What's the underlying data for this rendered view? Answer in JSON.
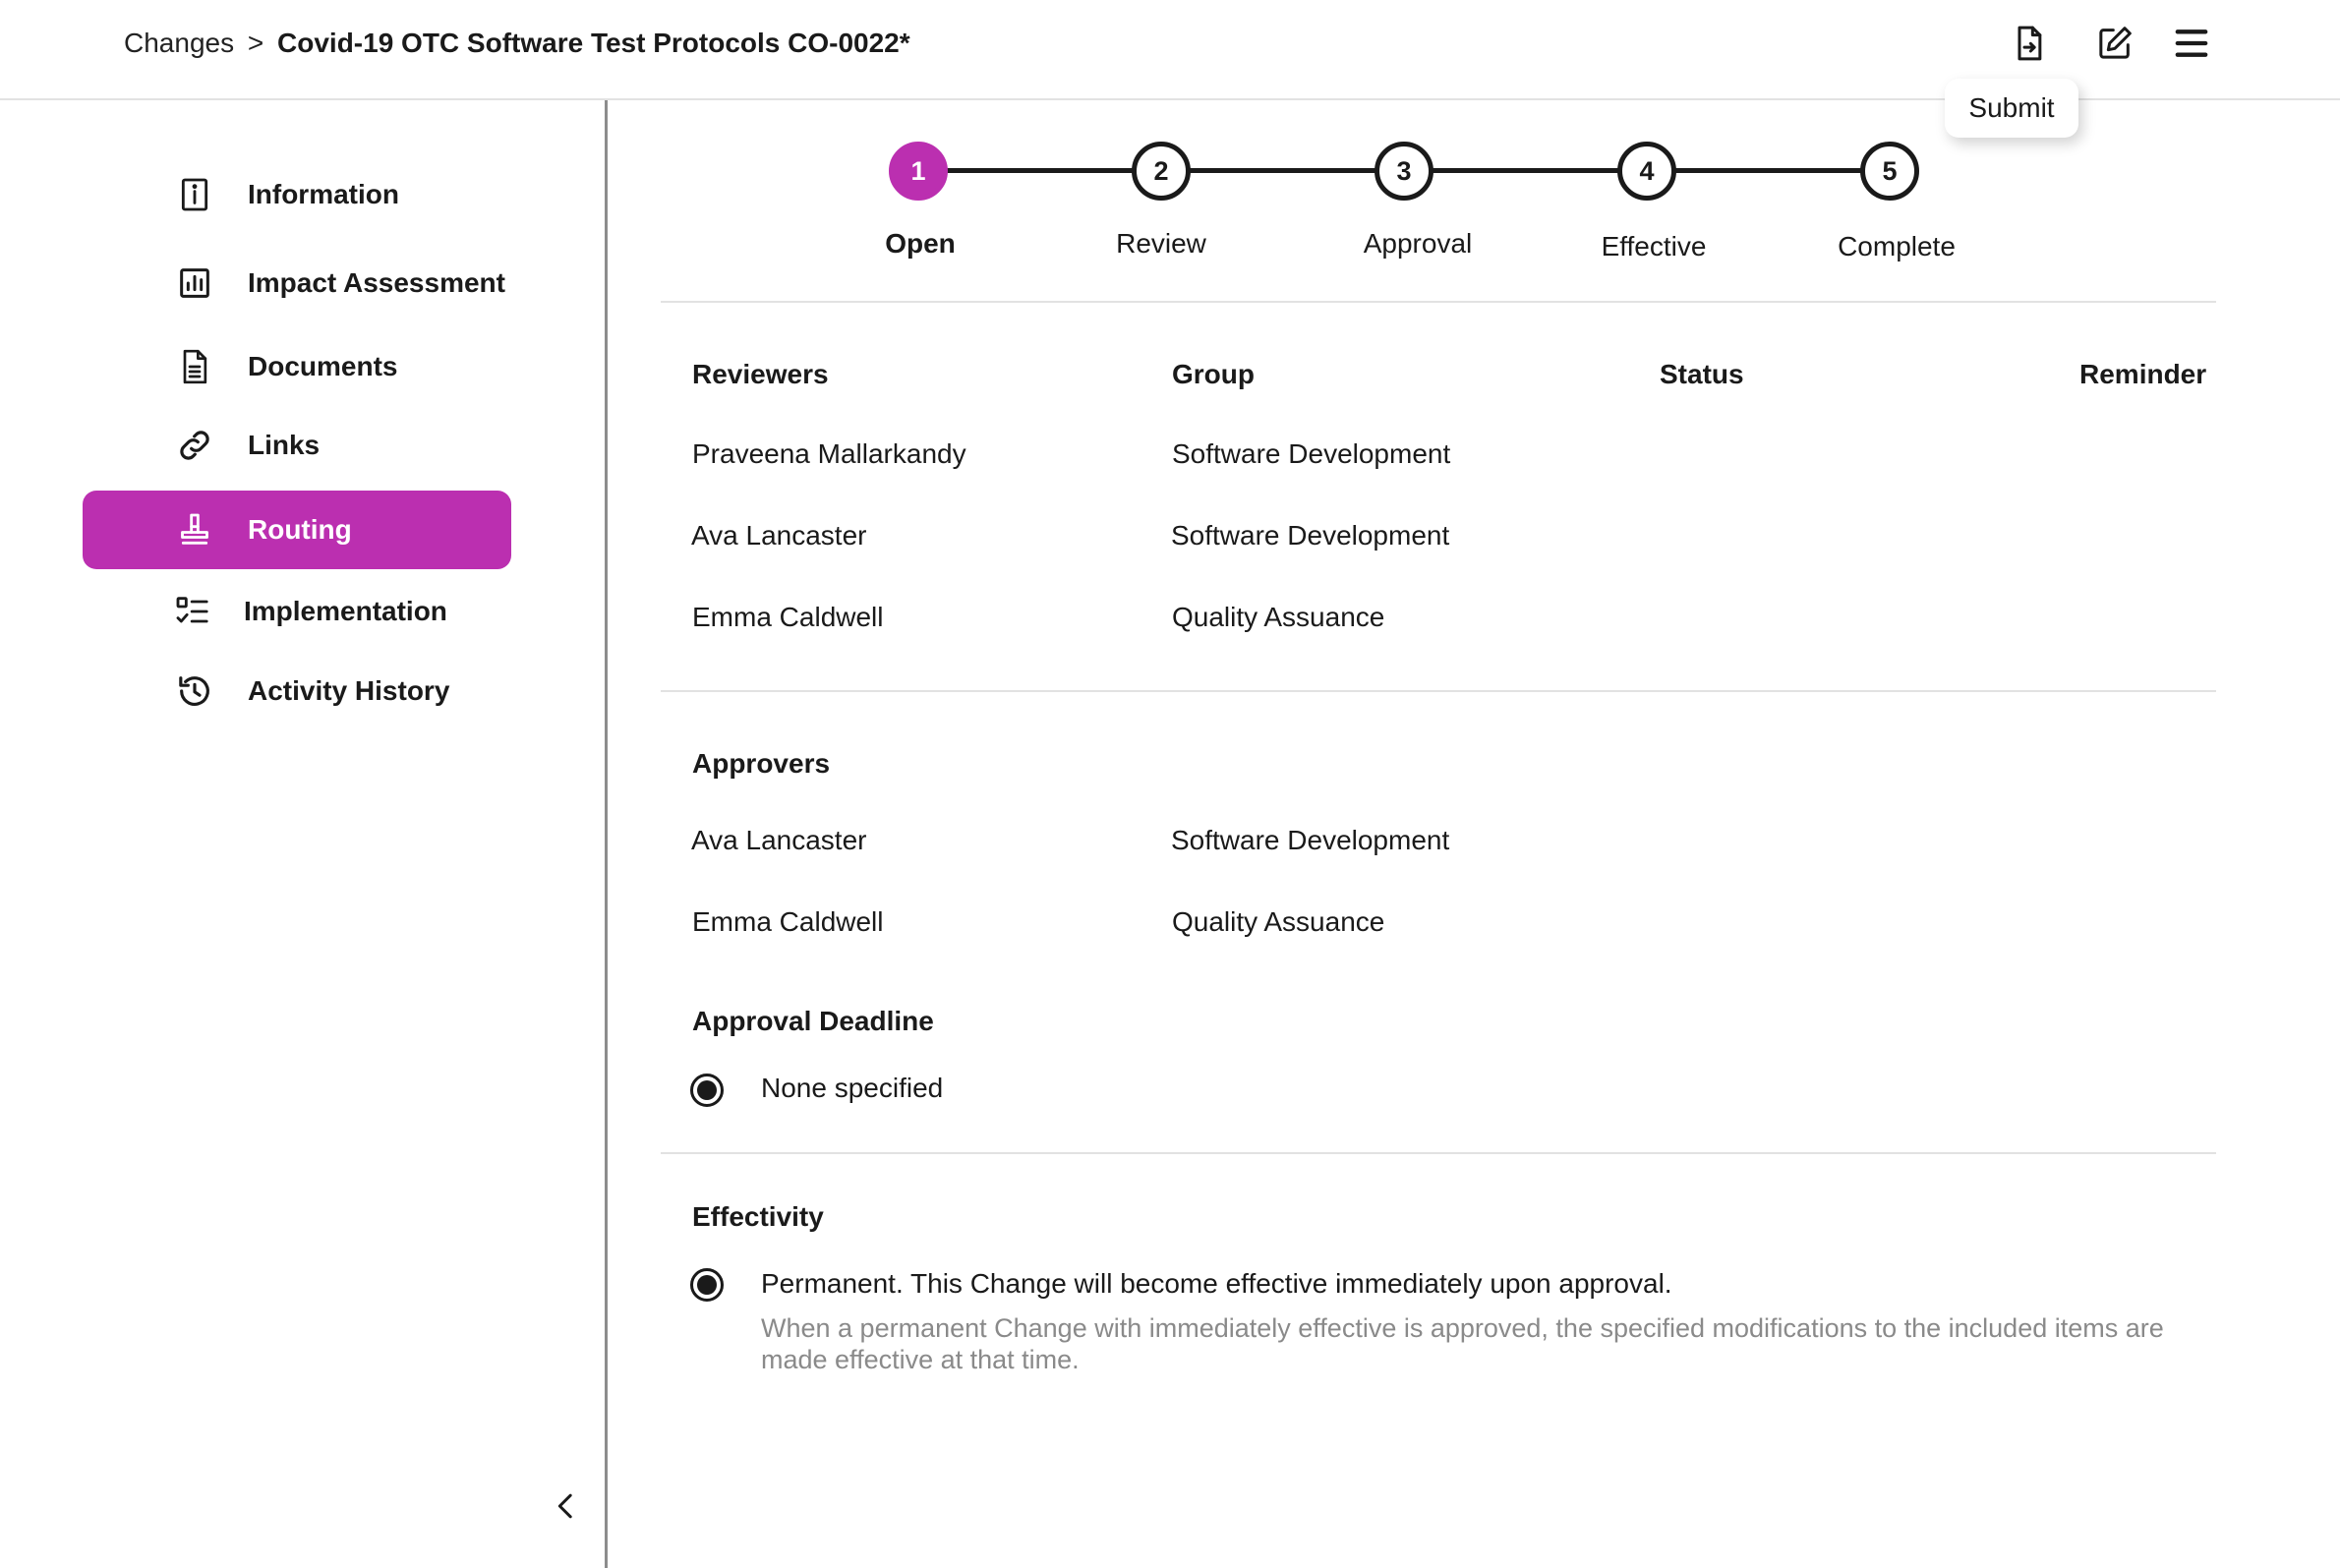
{
  "breadcrumb": {
    "parent": "Changes",
    "separator": ">",
    "current": "Covid-19 OTC Software Test Protocols CO-0022*"
  },
  "header": {
    "tooltip": "Submit",
    "icons": [
      "submit-document-icon",
      "edit-icon",
      "menu-icon"
    ]
  },
  "sidebar": {
    "items": [
      {
        "label": "Information",
        "icon": "info-icon"
      },
      {
        "label": "Impact Assessment",
        "icon": "bar-chart-icon"
      },
      {
        "label": "Documents",
        "icon": "document-icon"
      },
      {
        "label": "Links",
        "icon": "link-icon"
      },
      {
        "label": "Routing",
        "icon": "stamp-icon",
        "active": true
      },
      {
        "label": "Implementation",
        "icon": "checklist-icon"
      },
      {
        "label": "Activity History",
        "icon": "history-icon"
      }
    ],
    "collapse_icon": "chevron-left-icon"
  },
  "stepper": {
    "steps": [
      {
        "number": "1",
        "label": "Open",
        "active": true
      },
      {
        "number": "2",
        "label": "Review"
      },
      {
        "number": "3",
        "label": "Approval"
      },
      {
        "number": "4",
        "label": "Effective"
      },
      {
        "number": "5",
        "label": "Complete"
      }
    ]
  },
  "reviewers": {
    "columns": [
      "Reviewers",
      "Group",
      "Status",
      "Reminder"
    ],
    "rows": [
      {
        "name": "Praveena Mallarkandy",
        "group": "Software Development"
      },
      {
        "name": "Ava Lancaster",
        "group": "Software Development"
      },
      {
        "name": "Emma Caldwell",
        "group": "Quality Assuance"
      }
    ]
  },
  "approvers": {
    "title": "Approvers",
    "rows": [
      {
        "name": "Ava Lancaster",
        "group": "Software Development"
      },
      {
        "name": "Emma Caldwell",
        "group": "Quality Assuance"
      }
    ]
  },
  "approval_deadline": {
    "title": "Approval Deadline",
    "option": "None specified"
  },
  "effectivity": {
    "title": "Effectivity",
    "option": "Permanent. This Change will become effective immediately upon approval.",
    "description": "When a permanent Change with immediately effective is approved, the specified modifications to the included items are made effective at that time."
  },
  "colors": {
    "accent": "#bb2fb0",
    "text": "#1a1a1a",
    "muted": "#8a8a8a",
    "divider": "#e2e2e2"
  }
}
